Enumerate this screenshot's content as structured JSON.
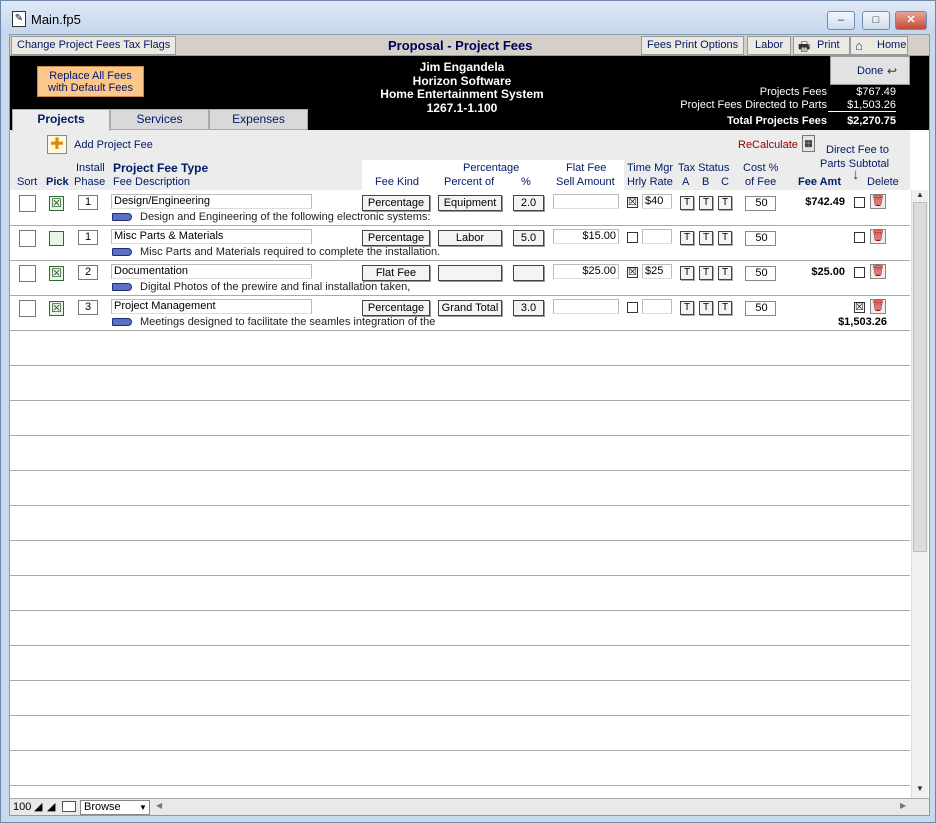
{
  "window": {
    "title": "Main.fp5",
    "minimize": "–",
    "maximize": "□",
    "close": "✕"
  },
  "menu": {
    "change_tax_flags": "Change Project Fees Tax Flags",
    "page_title": "Proposal - Project Fees",
    "fees_print_options": "Fees Print Options",
    "labor": "Labor",
    "print": "Print",
    "home": "Home"
  },
  "header": {
    "replace_btn": "Replace All Fees with Default Fees",
    "client_name": "Jim Engandela",
    "company": "Horizon Software",
    "system": "Home Entertainment System",
    "proposal_no": "1267.1-1.100",
    "done": "Done"
  },
  "summary": {
    "projects_fees_label": "Projects Fees",
    "projects_fees_value": "$767.49",
    "directed_label": "Project Fees Directed to Parts",
    "directed_value": "$1,503.26",
    "total_label": "Total Projects Fees",
    "total_value": "$2,270.75"
  },
  "tabs": [
    {
      "label": "Projects"
    },
    {
      "label": "Services"
    },
    {
      "label": "Expenses"
    }
  ],
  "toolbar": {
    "add_fee": "Add Project Fee",
    "recalculate": "ReCalculate",
    "direct_fee_1": "Direct Fee to",
    "direct_fee_2": "Parts Subtotal"
  },
  "columns": {
    "sort": "Sort",
    "pick": "Pick",
    "install": "Install",
    "phase": "Phase",
    "fee_type": "Project Fee Type",
    "fee_desc": "Fee Description",
    "fee_kind": "Fee Kind",
    "percentage": "Percentage",
    "percent_of": "Percent of",
    "pct": "%",
    "flat_fee": "Flat Fee",
    "sell_amount": "Sell Amount",
    "time_mgr": "Time Mgr",
    "hrly_rate": "Hrly Rate",
    "tax_status": "Tax Status",
    "tax_a": "A",
    "tax_b": "B",
    "tax_c": "C",
    "cost_pct": "Cost %",
    "of_fee": "of Fee",
    "fee_amt": "Fee Amt",
    "delete": "Delete"
  },
  "rows": [
    {
      "pick": "☒",
      "phase": "1",
      "type": "Design/Engineering",
      "desc": "Design and Engineering of  the following electronic systems:",
      "kind": "Percentage",
      "of": "Equipment",
      "pct": "2.0",
      "flat": "",
      "tm": "☒",
      "rate": "$40",
      "ta": "T",
      "tb": "T",
      "tc": "T",
      "cost": "50",
      "amt": "$742.49",
      "direct": ""
    },
    {
      "pick": "",
      "phase": "1",
      "type": "Misc Parts & Materials",
      "desc": "Misc Parts and Materials required to complete the installation.",
      "kind": "Percentage",
      "of": "Labor",
      "pct": "5.0",
      "flat": "$15.00",
      "tm": "",
      "rate": "",
      "ta": "T",
      "tb": "T",
      "tc": "T",
      "cost": "50",
      "amt": "",
      "direct": ""
    },
    {
      "pick": "☒",
      "phase": "2",
      "type": "Documentation",
      "desc": "Digital Photos of the prewire and final installation taken,",
      "kind": "Flat Fee",
      "of": "",
      "pct": "",
      "flat": "$25.00",
      "tm": "☒",
      "rate": "$25",
      "ta": "T",
      "tb": "T",
      "tc": "T",
      "cost": "50",
      "amt": "$25.00",
      "direct": ""
    },
    {
      "pick": "☒",
      "phase": "3",
      "type": "Project Management",
      "desc": "Meetings designed to facilitate the seamles integration of the",
      "kind": "Percentage",
      "of": "Grand Total",
      "pct": "3.0",
      "flat": "",
      "tm": "",
      "rate": "",
      "ta": "T",
      "tb": "T",
      "tc": "T",
      "cost": "50",
      "amt": "$1,503.26",
      "direct": "☒"
    }
  ],
  "status": {
    "zoom": "100",
    "mode": "Browse"
  }
}
